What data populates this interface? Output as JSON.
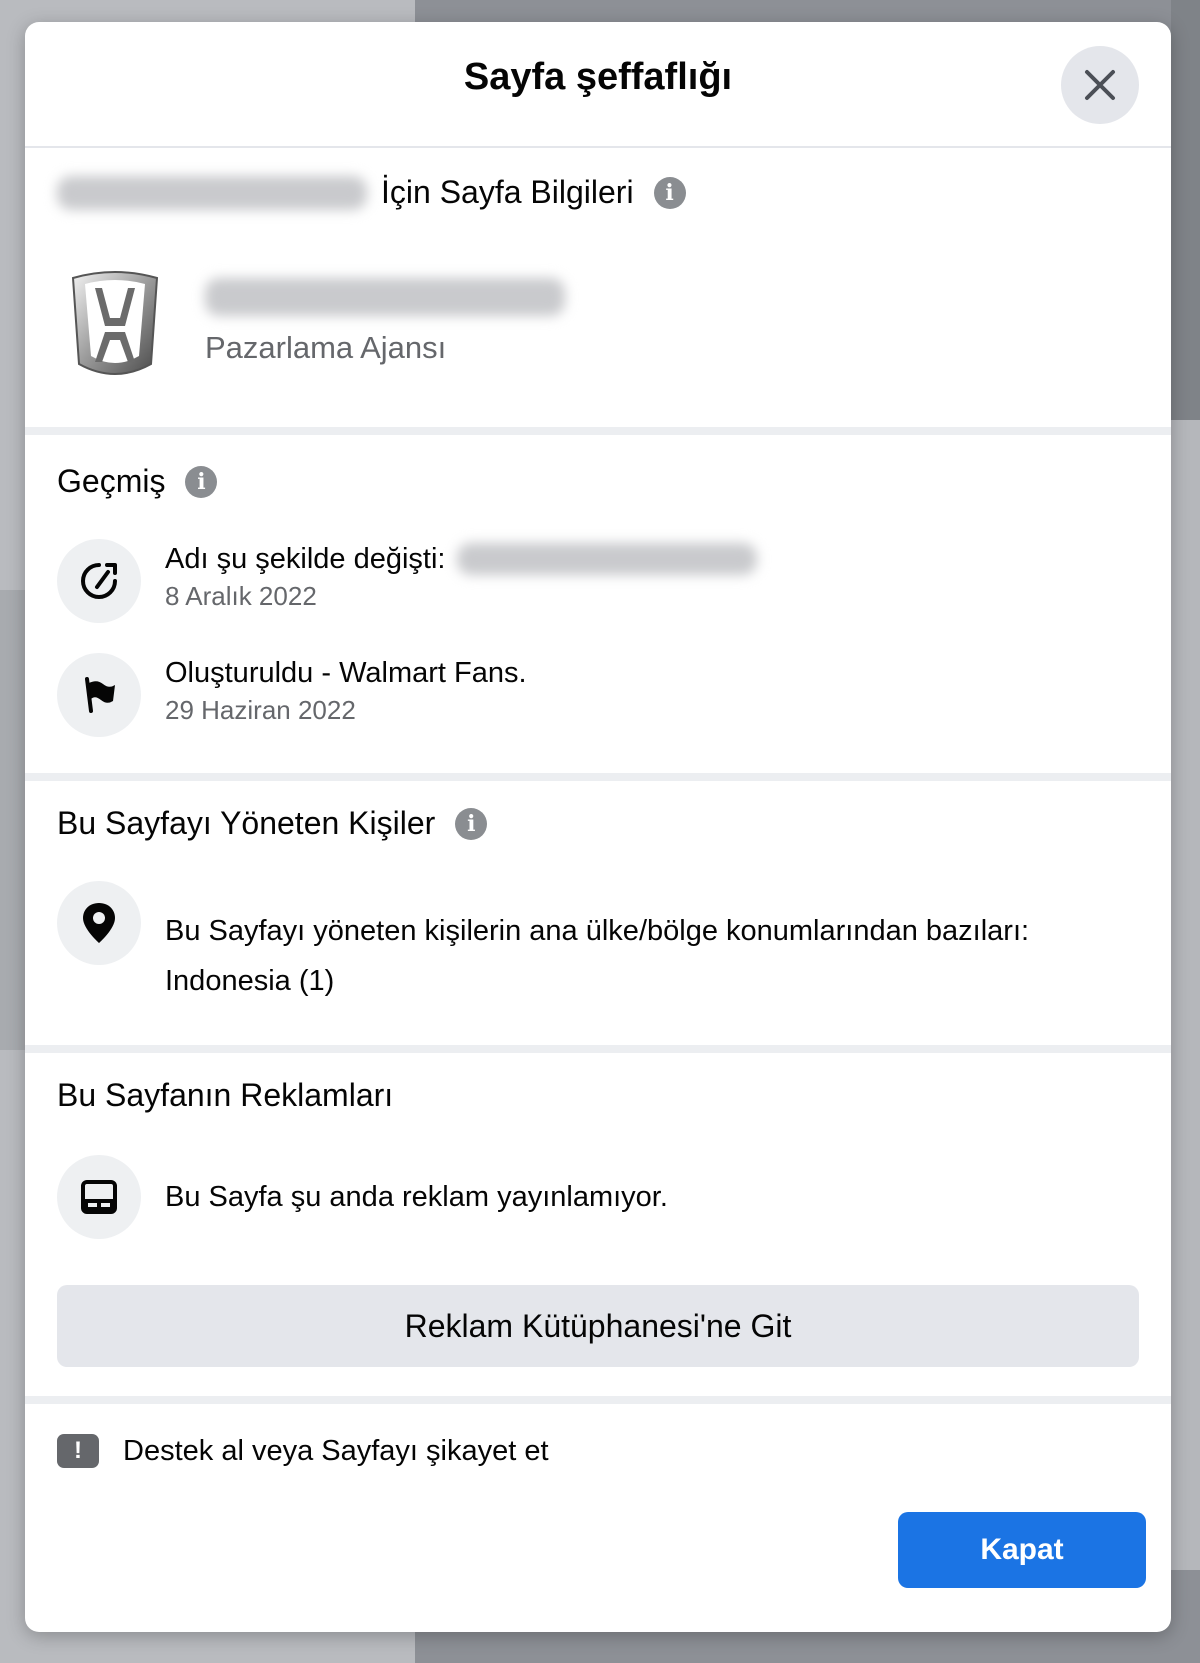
{
  "modal": {
    "title": "Sayfa şeffaflığı",
    "close_label": "Kapat"
  },
  "page_info": {
    "heading": "İçin Sayfa Bilgileri",
    "category": "Pazarlama Ajansı"
  },
  "history": {
    "heading": "Geçmiş",
    "items": [
      {
        "label": "Adı şu şekilde değişti:",
        "date": "8 Aralık 2022"
      },
      {
        "label": "Oluşturuldu - Walmart Fans.",
        "date": "29 Haziran 2022"
      }
    ]
  },
  "managers": {
    "heading": "Bu Sayfayı Yöneten Kişiler",
    "text": "Bu Sayfayı yöneten kişilerin ana ülke/bölge konumlarından bazıları:",
    "countries": "Indonesia (1)"
  },
  "ads": {
    "heading": "Bu Sayfanın Reklamları",
    "status": "Bu Sayfa şu anda reklam yayınlamıyor.",
    "library_button": "Reklam Kütüphanesi'ne Git"
  },
  "support": {
    "label": "Destek al veya Sayfayı şikayet et"
  },
  "colors": {
    "primary_button": "#1b74e4",
    "secondary_button": "#e4e6eb"
  }
}
